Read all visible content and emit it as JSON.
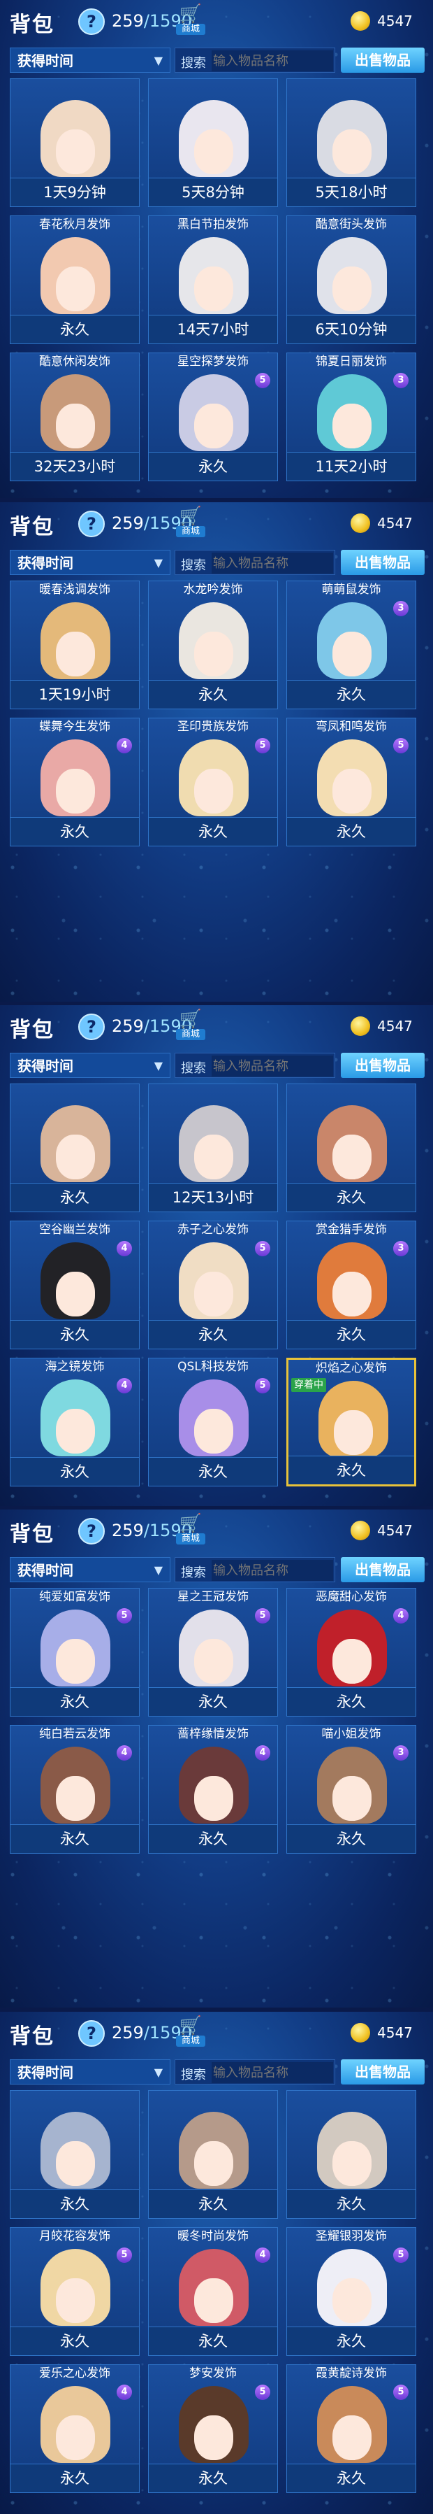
{
  "header": {
    "title": "背包",
    "help": "?",
    "count_current": "259",
    "count_max": "/1590",
    "shop_label": "商城",
    "gold": "4547"
  },
  "filter": {
    "selected": "获得时间"
  },
  "search": {
    "label": "搜索",
    "placeholder": "输入物品名称"
  },
  "sell_button": "出售物品",
  "panels": [
    {
      "items": [
        {
          "name": "",
          "duration": "1天9分钟",
          "hair": "#f0d9c4"
        },
        {
          "name": "",
          "duration": "5天8分钟",
          "hair": "#e9e6ef"
        },
        {
          "name": "",
          "duration": "5天18小时",
          "hair": "#d9dbe3"
        },
        {
          "name": "春花秋月发饰",
          "duration": "永久",
          "hair": "#f2c9b0"
        },
        {
          "name": "黑白节拍发饰",
          "duration": "14天7小时",
          "hair": "#e6e6ea"
        },
        {
          "name": "酷意街头发饰",
          "duration": "6天10分钟",
          "hair": "#e0e2ea"
        },
        {
          "name": "酷意休闲发饰",
          "duration": "32天23小时",
          "hair": "#c89a7a"
        },
        {
          "name": "星空探梦发饰",
          "duration": "永久",
          "hair": "#c9cbe4",
          "lvl": "5"
        },
        {
          "name": "锦夏日丽发饰",
          "duration": "11天2小时",
          "hair": "#5fc9d6",
          "lvl": "3"
        }
      ]
    },
    {
      "items": [
        {
          "name": "暖春浅调发饰",
          "duration": "1天19小时",
          "hair": "#e4b97a"
        },
        {
          "name": "水龙吟发饰",
          "duration": "永久",
          "hair": "#eae6e0"
        },
        {
          "name": "萌萌鼠发饰",
          "duration": "永久",
          "hair": "#7ec7e8",
          "lvl": "3"
        },
        {
          "name": "蝶舞今生发饰",
          "duration": "永久",
          "hair": "#e9a9a6",
          "lvl": "4"
        },
        {
          "name": "圣印贵族发饰",
          "duration": "永久",
          "hair": "#f0dcb0",
          "lvl": "5"
        },
        {
          "name": "弯凤和鸣发饰",
          "duration": "永久",
          "hair": "#f3ddb2",
          "lvl": "5"
        }
      ]
    },
    {
      "items": [
        {
          "name": "",
          "duration": "永久",
          "hair": "#d8b49a"
        },
        {
          "name": "",
          "duration": "12天13小时",
          "hair": "#c7c5cc"
        },
        {
          "name": "",
          "duration": "永久",
          "hair": "#c9866a"
        },
        {
          "name": "空谷幽兰发饰",
          "duration": "永久",
          "hair": "#222226",
          "lvl": "4"
        },
        {
          "name": "赤子之心发饰",
          "duration": "永久",
          "hair": "#f0ddc4",
          "lvl": "5"
        },
        {
          "name": "赏金猎手发饰",
          "duration": "永久",
          "hair": "#e07b3c",
          "lvl": "3"
        },
        {
          "name": "海之镜发饰",
          "duration": "永久",
          "hair": "#7fd9e0",
          "lvl": "4"
        },
        {
          "name": "QSL科技发饰",
          "duration": "永久",
          "hair": "#a88ee8",
          "lvl": "5"
        },
        {
          "name": "炽焰之心发饰",
          "duration": "永久",
          "hair": "#e9b25e",
          "wearing": "穿着中"
        }
      ]
    },
    {
      "items": [
        {
          "name": "纯爱如富发饰",
          "duration": "永久",
          "hair": "#a7aee8",
          "lvl": "5"
        },
        {
          "name": "星之王冠发饰",
          "duration": "永久",
          "hair": "#e2e0ea",
          "lvl": "5"
        },
        {
          "name": "恶魔甜心发饰",
          "duration": "永久",
          "hair": "#c0202a",
          "lvl": "4"
        },
        {
          "name": "纯白若云发饰",
          "duration": "永久",
          "hair": "#8a5a48",
          "lvl": "4"
        },
        {
          "name": "蔷梓缘情发饰",
          "duration": "永久",
          "hair": "#6a3a3a",
          "lvl": "4"
        },
        {
          "name": "喵小姐发饰",
          "duration": "永久",
          "hair": "#a37a5e",
          "lvl": "3"
        }
      ]
    },
    {
      "items": [
        {
          "name": "",
          "duration": "永久",
          "hair": "#a6b4cf"
        },
        {
          "name": "",
          "duration": "永久",
          "hair": "#b59a8a"
        },
        {
          "name": "",
          "duration": "永久",
          "hair": "#d2c9c0"
        },
        {
          "name": "月皎花容发饰",
          "duration": "永久",
          "hair": "#f0d7a4",
          "lvl": "5"
        },
        {
          "name": "暖冬时尚发饰",
          "duration": "永久",
          "hair": "#d05a66",
          "lvl": "4"
        },
        {
          "name": "圣耀银羽发饰",
          "duration": "永久",
          "hair": "#eeeef6",
          "lvl": "5"
        },
        {
          "name": "爱乐之心发饰",
          "duration": "永久",
          "hair": "#e9c89a",
          "lvl": "4"
        },
        {
          "name": "梦安发饰",
          "duration": "永久",
          "hair": "#5a3a2a",
          "lvl": "5"
        },
        {
          "name": "霞黄靛诗发饰",
          "duration": "永久",
          "hair": "#c98a5a",
          "lvl": "5"
        }
      ]
    }
  ]
}
